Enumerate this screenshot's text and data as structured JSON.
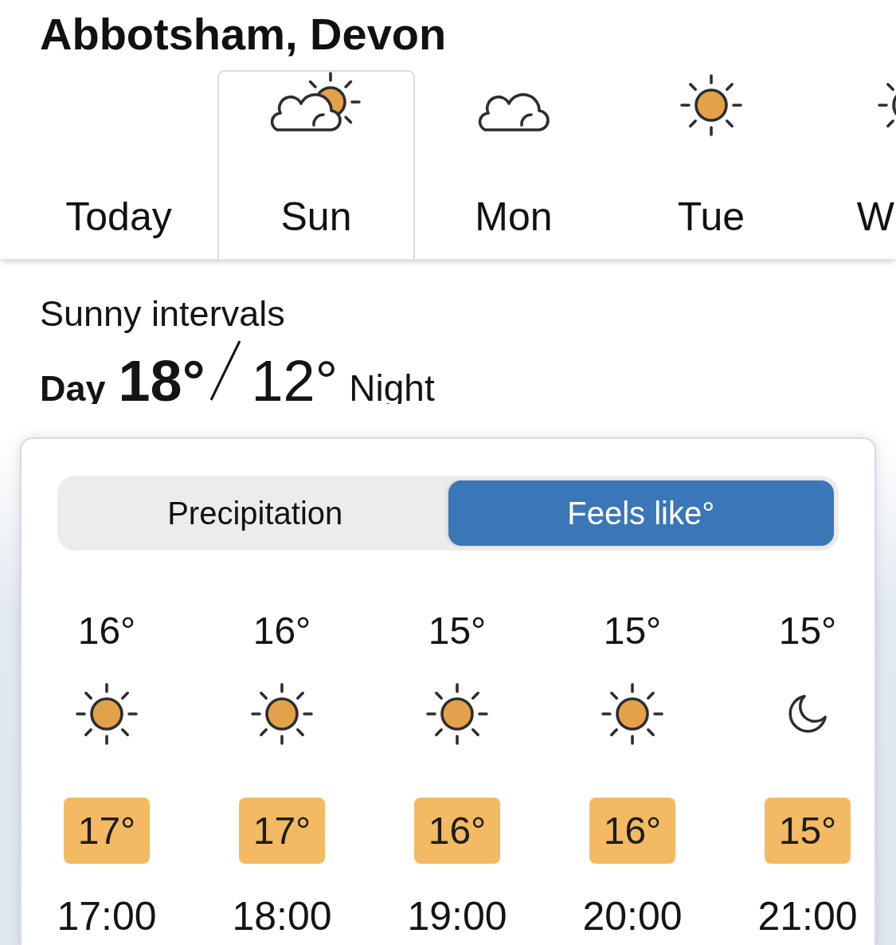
{
  "location": {
    "title": "Abbotsham, Devon"
  },
  "day_tabs": [
    {
      "label": "Today",
      "selected": false,
      "kind": "plain"
    },
    {
      "label": "Sun",
      "selected": true,
      "kind": "sunny-intervals"
    },
    {
      "label": "Mon",
      "selected": false,
      "kind": "cloudy"
    },
    {
      "label": "Tue",
      "selected": false,
      "kind": "sunny"
    },
    {
      "label": "W",
      "selected": false,
      "kind": "sunny"
    }
  ],
  "summary": {
    "description": "Sunny intervals",
    "day_label": "Day",
    "day_temperature": "18°",
    "night_temperature": "12°",
    "night_label": "Night"
  },
  "forecast_panel": {
    "view_toggle": [
      {
        "label": "Precipitation",
        "selected": false
      },
      {
        "label": "Feels like°",
        "selected": true
      }
    ],
    "hours": [
      {
        "temperature": "16°",
        "kind": "sunny",
        "feels_like": "17°",
        "time": "17:00"
      },
      {
        "temperature": "16°",
        "kind": "sunny",
        "feels_like": "17°",
        "time": "18:00"
      },
      {
        "temperature": "15°",
        "kind": "sunny",
        "feels_like": "16°",
        "time": "19:00"
      },
      {
        "temperature": "15°",
        "kind": "sunny",
        "feels_like": "16°",
        "time": "20:00"
      },
      {
        "temperature": "15°",
        "kind": "clear-night",
        "feels_like": "15°",
        "time": "21:00"
      }
    ]
  }
}
